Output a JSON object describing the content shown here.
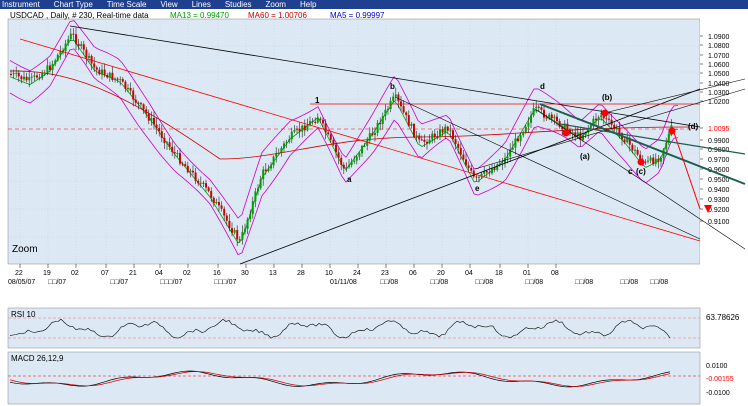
{
  "menu": [
    "Instrument",
    "Chart Type",
    "Time Scale",
    "View",
    "Lines",
    "Studies",
    "Zoom",
    "Help"
  ],
  "colors": {
    "menu_bg": "#1f3f8f",
    "panel_bg": "#dce8f4",
    "price_bars": "#222222",
    "bar_up": "#00a000",
    "bar_down": "#d00000",
    "bollinger": "#cc00cc",
    "ma13": "#00a000",
    "ma60": "#cc0000",
    "ma5": "#0000cc",
    "trendline": "#000000",
    "red_line": "#ff0000",
    "teal_line": "#1d5f4f"
  },
  "header": {
    "symbol": "USDCAD , Daily, # 230, Real-time data",
    "ma13_label": "MA13 = 0.99470",
    "ma60_label": "MA60 = 1.00706",
    "ma5_label": "MA5 = 0.99997"
  },
  "price_axis": [
    "1.0900",
    "1.0800",
    "1.0700",
    "1.0600",
    "1.0500",
    "1.0400",
    "1.0300",
    "1.0200",
    "1.0095",
    "0.9900",
    "0.9800",
    "0.9700",
    "0.9600",
    "0.9500",
    "0.9400",
    "0.9300",
    "0.9200",
    "0.9100"
  ],
  "x_ticks": [
    "22",
    "19",
    "02",
    "07",
    "21",
    "04",
    "02",
    "16",
    "30",
    "13",
    "28",
    "10",
    "24",
    "23",
    "06",
    "20",
    "04",
    "18",
    "01",
    "08"
  ],
  "x_sub": [
    "08/05/07",
    "□□/07",
    "□□/07",
    "□□□/07",
    "□□□/07",
    "01/11/08",
    "□□/08",
    "□□/08",
    "□□/08",
    "□□/08",
    "□□/08",
    "□□/08",
    "□□/08"
  ],
  "annotations": [
    "1",
    "a",
    "b",
    "c",
    "d",
    "e",
    "(a)",
    "(b)",
    "(c)",
    "(d)"
  ],
  "zoom_label": "Zoom",
  "rsi": {
    "label": "RSI 10",
    "value": "63.78626"
  },
  "macd": {
    "label": "MACD 26,12,9",
    "ticks": [
      "0.0100",
      "-0.00155",
      "-0.0100"
    ]
  }
}
